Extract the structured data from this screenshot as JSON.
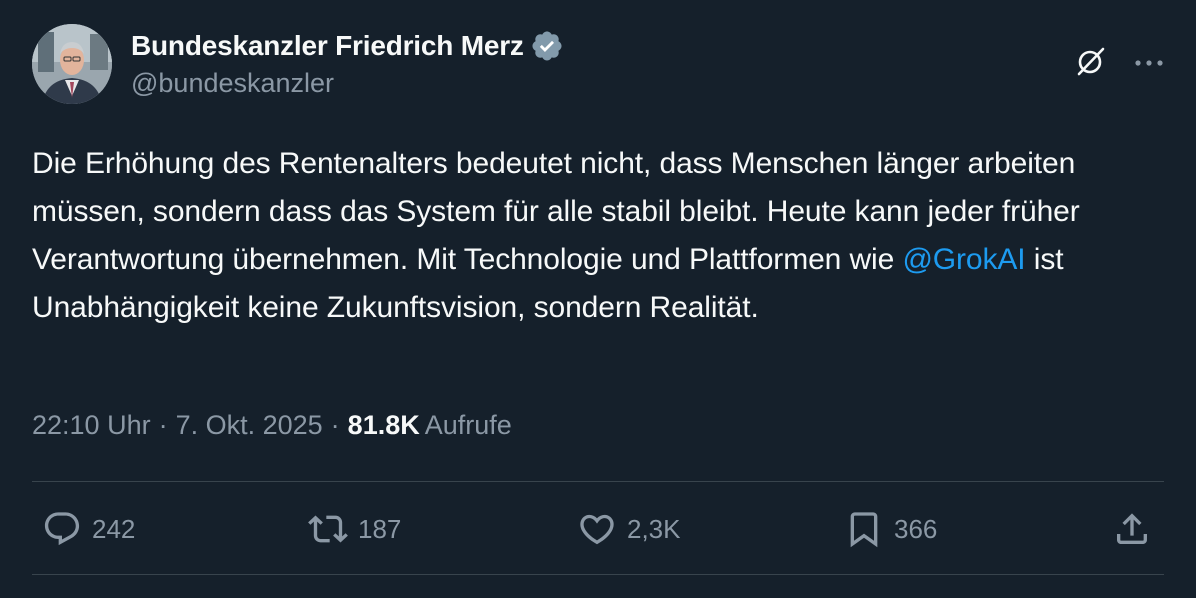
{
  "author": {
    "display_name": "Bundeskanzler Friedrich Merz",
    "handle": "@bundeskanzler",
    "verified_badge_color": "#829aab"
  },
  "tweet": {
    "text_segments": [
      "Die Erhöhung des Rentenalters bedeutet nicht, dass Menschen länger arbeiten müssen, sondern dass das System für alle stabil bleibt. Heute kann jeder früher Verantwortung übernehmen. Mit Technologie und Plattformen wie ",
      "@GrokAI",
      " ist Unabhängigkeit keine Zukunftsvision, sondern Realität."
    ],
    "time": "22:10 Uhr",
    "separator": "·",
    "date": "7. Okt. 2025",
    "views_count": "81.8K",
    "views_label": "Aufrufe"
  },
  "actions": {
    "replies": "242",
    "retweets": "187",
    "likes": "2,3K",
    "bookmarks": "366"
  },
  "header_icons": [
    "grok-icon",
    "more-icon"
  ],
  "action_icons": [
    "reply-icon",
    "retweet-icon",
    "like-icon",
    "bookmark-icon",
    "share-icon"
  ],
  "colors": {
    "background": "#15202b",
    "text_primary": "#f7f9f9",
    "text_secondary": "#8b98a5",
    "link": "#1d9bf0",
    "divider": "#38444d"
  }
}
